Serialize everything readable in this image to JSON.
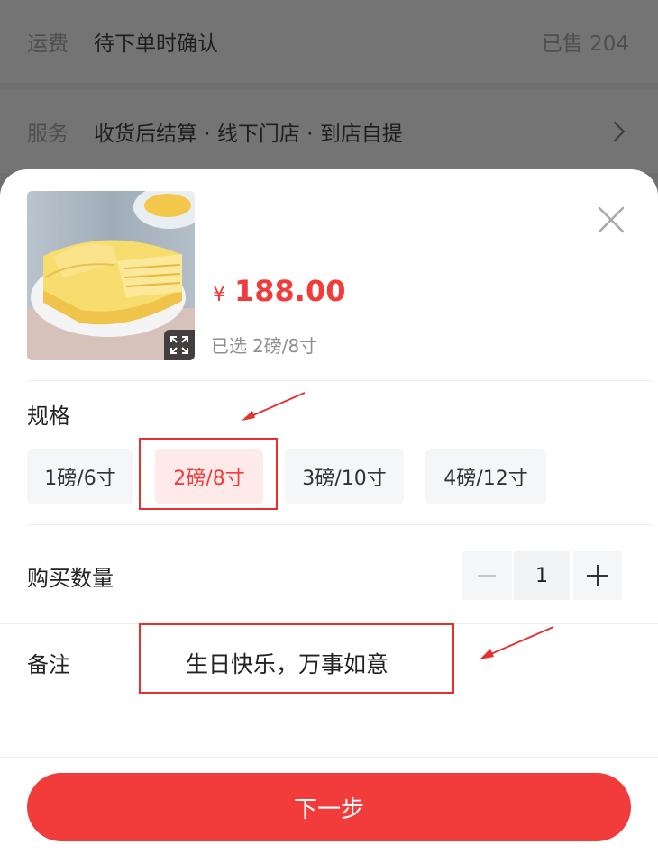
{
  "background": {
    "shipping_label": "运费",
    "shipping_value": "待下单时确认",
    "sold_count": "已售 204",
    "service_label": "服务",
    "service_value": "收货后结算 · 线下门店 · 到店自提"
  },
  "sheet": {
    "product_image": "durian-crepe-cake",
    "price_currency": "¥",
    "price_amount": "188.00",
    "selected_prefix": "已选",
    "selected_value": "2磅/8寸",
    "spec_title": "规格",
    "spec_options": [
      "1磅/6寸",
      "2磅/8寸",
      "3磅/10寸",
      "4磅/12寸"
    ],
    "spec_selected_index": 1,
    "quantity_label": "购买数量",
    "quantity_value": "1",
    "remark_label": "备注",
    "remark_value": "生日快乐，万事如意",
    "next_button": "下一步"
  },
  "colors": {
    "accent": "#f23b3b",
    "annotation": "#e53030"
  }
}
